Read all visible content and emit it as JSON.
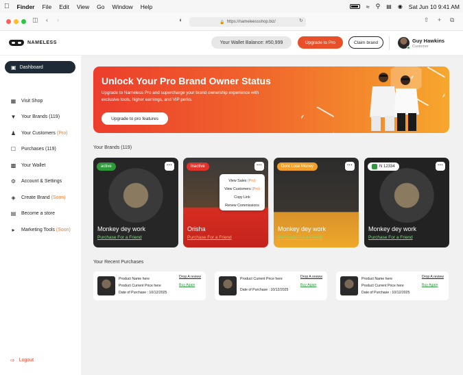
{
  "menubar": {
    "apple": "",
    "items": [
      "Finder",
      "File",
      "Edit",
      "View",
      "Go",
      "Window",
      "Help"
    ],
    "datetime": "Sat Jun 10  9:41 AM"
  },
  "browser": {
    "url": "https://nameleessshop.biz/"
  },
  "header": {
    "brand": "NAMELESS",
    "wallet": "Your Wallet Balance: #50,999",
    "upgrade_button": "Upgrade to Pro",
    "claim_button": "Claim brand",
    "user_name": "Guy Hawkins",
    "user_role": "Customer"
  },
  "sidebar": {
    "dashboard": "Dashboard",
    "items": [
      {
        "label": "Visit Shop",
        "icon": "shop-icon",
        "suffix": ""
      },
      {
        "label": "Your Brands (119)",
        "icon": "shirt-icon",
        "suffix": ""
      },
      {
        "label": "Your Customers",
        "icon": "customers-icon",
        "suffix": "(Pro)"
      },
      {
        "label": "Purchases (119)",
        "icon": "bag-icon",
        "suffix": ""
      },
      {
        "label": "Your Wallet",
        "icon": "wallet-icon",
        "suffix": ""
      },
      {
        "label": "Account & Settings",
        "icon": "gear-icon",
        "suffix": ""
      },
      {
        "label": "Create Brand",
        "icon": "tag-icon",
        "suffix": "(Soon)"
      },
      {
        "label": "Become a store",
        "icon": "store-icon",
        "suffix": ""
      },
      {
        "label": "Marketing Tools",
        "icon": "megaphone-icon",
        "suffix": "(Soon)"
      }
    ],
    "logout": "Logout"
  },
  "banner": {
    "title": "Unlock Your Pro Brand Owner Status",
    "description": "Upgrade to Nameless Pro and supercharge your brand ownership experience with exclusive tools, higher earnings, and VIP perks.",
    "button": "Upgrade to pro features"
  },
  "brands": {
    "title": "Your Brands (119)",
    "cards": [
      {
        "badge": "active",
        "badge_color": "#2e9a3c",
        "name": "Monkey dey work",
        "link": "Purchase For a Friend",
        "bg": "#2b2b2b"
      },
      {
        "badge": "Inactive",
        "badge_color": "#e0332a",
        "name": "Orisha",
        "link": "Purchase For a Friend",
        "bg": "#d42c22"
      },
      {
        "badge": "Dont Lose Money",
        "badge_color": "#f0a028",
        "name": "Monkey dey work",
        "link": "Purchase For a Friend",
        "bg": "#e8a12a"
      },
      {
        "badge": "N 12334",
        "badge_color": "#ffffff",
        "name": "Monkey dey work",
        "link": "Purchase For a Friend",
        "bg": "#222222"
      }
    ],
    "menu": {
      "view_sales": "View Sales",
      "view_sales_tag": "(Pro)",
      "view_customers": "View Customers",
      "view_customers_tag": "(Pro)",
      "copy_link": "Copy Link",
      "renew": "Renew Commissions"
    }
  },
  "purchases": {
    "title": "Your Recent Purchases",
    "cards": [
      {
        "lines": [
          "Product Name here",
          "Product Current Price here",
          "Date of Purchase : 10/12/2025"
        ],
        "review": "Drop A review",
        "buy": "Buy Again"
      },
      {
        "lines": [
          "Product Current Price here",
          "Date of Purchase : 10/12/2025"
        ],
        "review": "Drop A review",
        "buy": "Buy Again"
      },
      {
        "lines": [
          "Product Name here",
          "Product Current Price here",
          "Date of Purchase : 10/12/2025"
        ],
        "review": "Drop A review",
        "buy": "Buy Again"
      }
    ]
  }
}
